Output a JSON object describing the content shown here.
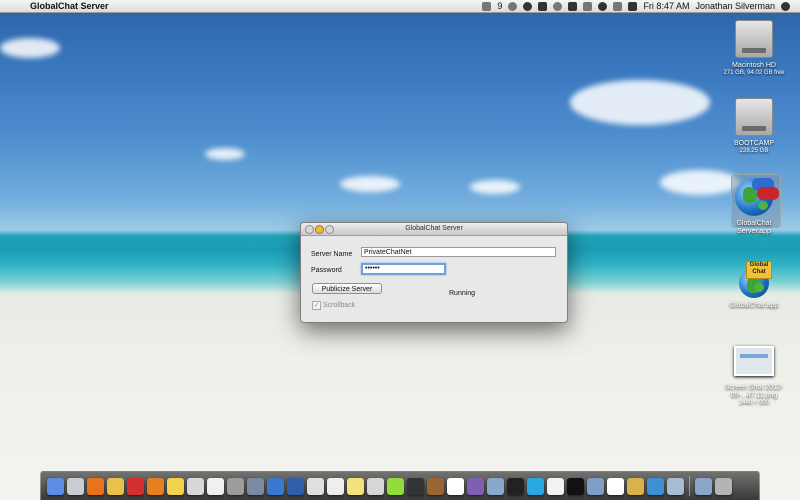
{
  "menubar": {
    "app_name": "GlobalChat Server",
    "badge_count": "9",
    "clock": "Fri 8:47 AM",
    "user": "Jonathan Silverman"
  },
  "desktop": {
    "items": [
      {
        "name": "Macintosh HD",
        "sub": "271 GB, 94.02 GB free",
        "icon": "hard-drive-icon"
      },
      {
        "name": "BOOTCAMP",
        "sub": "228.25 GB",
        "icon": "hard-drive-icon"
      },
      {
        "name": "GlobalChat Server.app",
        "sub": "",
        "icon": "globalchat-server-icon"
      },
      {
        "name": "GlobalChat.app",
        "sub": "",
        "icon": "globalchat-icon",
        "badge": "Global Chat"
      },
      {
        "name": "Screen Shot 2012-09-...47.11.png",
        "sub": "1440 × 900",
        "icon": "screenshot-icon"
      }
    ]
  },
  "window": {
    "title": "GlobalChat Server",
    "server_name_label": "Server Name",
    "server_name_value": "PrivateChatNet",
    "password_label": "Password",
    "password_value": "••••••",
    "publicize_label": "Publicize Server",
    "status": "Running",
    "scrollback_label": "Scrollback"
  },
  "dock": {
    "icons": [
      "finder-icon",
      "rocket-icon",
      "firefox-icon",
      "chrome-icon",
      "s-app-icon",
      "vlc-icon",
      "star-icon",
      "boxes-icon",
      "pd-icon",
      "gear-icon",
      "folder-icon",
      "globe-icon",
      "sync-icon",
      "textedit-icon",
      "list-icon",
      "notes-icon",
      "mail-icon",
      "limechat-icon",
      "cat-icon",
      "game-icon",
      "calendar-icon",
      "photo-icon",
      "app-icon",
      "dvd-icon",
      "skype-icon",
      "ball-icon",
      "terminal-icon",
      "pencil-icon",
      "activity-icon",
      "preview-icon",
      "globe2-icon",
      "folder2-icon",
      "downloads-icon",
      "trash-icon"
    ],
    "colors": [
      "#5d8ee6",
      "#c9cdd4",
      "#e8731a",
      "#e7c14a",
      "#d62f2f",
      "#e77f21",
      "#f2d44b",
      "#d8d8d8",
      "#f0f0f0",
      "#9c9c9c",
      "#7a8aa0",
      "#3b79d1",
      "#2f5fa8",
      "#e0e0e0",
      "#eeeeee",
      "#f4e27a",
      "#d7d7d7",
      "#8fdc3a",
      "#333333",
      "#996633",
      "#ffffff",
      "#7f5fb3",
      "#88a8cc",
      "#222222",
      "#28a9e0",
      "#f3f3f3",
      "#111111",
      "#7f9fc7",
      "#ffffff",
      "#d9b24c",
      "#3d8fd6",
      "#a8bcd3",
      "#8aa7c9",
      "#b4b4b4"
    ]
  }
}
